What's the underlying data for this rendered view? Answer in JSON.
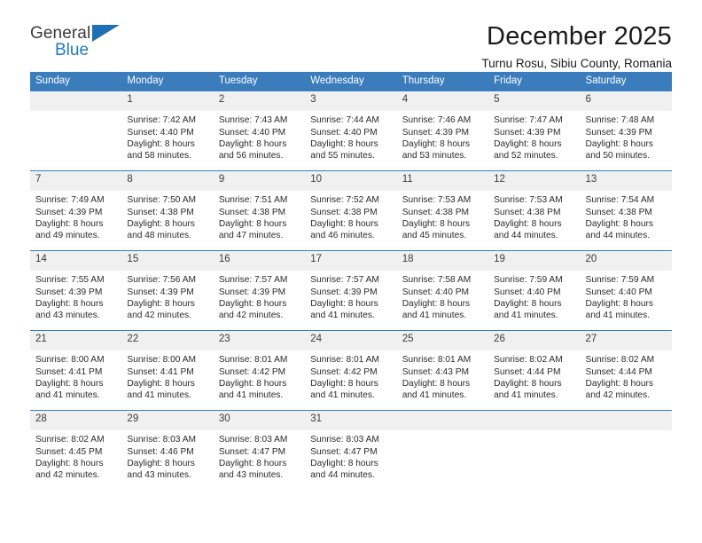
{
  "brand": {
    "name_top": "General",
    "name_bottom": "Blue",
    "triangle_color": "#1f6fb5",
    "text_color": "#3b3b3b",
    "accent_color": "#1f7ac4"
  },
  "header": {
    "title": "December 2025",
    "subtitle": "Turnu Rosu, Sibiu County, Romania"
  },
  "theme": {
    "header_bg": "#3b7cbd",
    "header_text": "#ffffff",
    "daynum_bg": "#f0f0f0",
    "grid_line": "#3b7cbd"
  },
  "weekday_headers": [
    "Sunday",
    "Monday",
    "Tuesday",
    "Wednesday",
    "Thursday",
    "Friday",
    "Saturday"
  ],
  "weeks": [
    [
      {
        "day": "",
        "sunrise": "",
        "sunset": "",
        "daylight_line1": "",
        "daylight_line2": ""
      },
      {
        "day": "1",
        "sunrise": "Sunrise: 7:42 AM",
        "sunset": "Sunset: 4:40 PM",
        "daylight_line1": "Daylight: 8 hours",
        "daylight_line2": "and 58 minutes."
      },
      {
        "day": "2",
        "sunrise": "Sunrise: 7:43 AM",
        "sunset": "Sunset: 4:40 PM",
        "daylight_line1": "Daylight: 8 hours",
        "daylight_line2": "and 56 minutes."
      },
      {
        "day": "3",
        "sunrise": "Sunrise: 7:44 AM",
        "sunset": "Sunset: 4:40 PM",
        "daylight_line1": "Daylight: 8 hours",
        "daylight_line2": "and 55 minutes."
      },
      {
        "day": "4",
        "sunrise": "Sunrise: 7:46 AM",
        "sunset": "Sunset: 4:39 PM",
        "daylight_line1": "Daylight: 8 hours",
        "daylight_line2": "and 53 minutes."
      },
      {
        "day": "5",
        "sunrise": "Sunrise: 7:47 AM",
        "sunset": "Sunset: 4:39 PM",
        "daylight_line1": "Daylight: 8 hours",
        "daylight_line2": "and 52 minutes."
      },
      {
        "day": "6",
        "sunrise": "Sunrise: 7:48 AM",
        "sunset": "Sunset: 4:39 PM",
        "daylight_line1": "Daylight: 8 hours",
        "daylight_line2": "and 50 minutes."
      }
    ],
    [
      {
        "day": "7",
        "sunrise": "Sunrise: 7:49 AM",
        "sunset": "Sunset: 4:39 PM",
        "daylight_line1": "Daylight: 8 hours",
        "daylight_line2": "and 49 minutes."
      },
      {
        "day": "8",
        "sunrise": "Sunrise: 7:50 AM",
        "sunset": "Sunset: 4:38 PM",
        "daylight_line1": "Daylight: 8 hours",
        "daylight_line2": "and 48 minutes."
      },
      {
        "day": "9",
        "sunrise": "Sunrise: 7:51 AM",
        "sunset": "Sunset: 4:38 PM",
        "daylight_line1": "Daylight: 8 hours",
        "daylight_line2": "and 47 minutes."
      },
      {
        "day": "10",
        "sunrise": "Sunrise: 7:52 AM",
        "sunset": "Sunset: 4:38 PM",
        "daylight_line1": "Daylight: 8 hours",
        "daylight_line2": "and 46 minutes."
      },
      {
        "day": "11",
        "sunrise": "Sunrise: 7:53 AM",
        "sunset": "Sunset: 4:38 PM",
        "daylight_line1": "Daylight: 8 hours",
        "daylight_line2": "and 45 minutes."
      },
      {
        "day": "12",
        "sunrise": "Sunrise: 7:53 AM",
        "sunset": "Sunset: 4:38 PM",
        "daylight_line1": "Daylight: 8 hours",
        "daylight_line2": "and 44 minutes."
      },
      {
        "day": "13",
        "sunrise": "Sunrise: 7:54 AM",
        "sunset": "Sunset: 4:38 PM",
        "daylight_line1": "Daylight: 8 hours",
        "daylight_line2": "and 44 minutes."
      }
    ],
    [
      {
        "day": "14",
        "sunrise": "Sunrise: 7:55 AM",
        "sunset": "Sunset: 4:39 PM",
        "daylight_line1": "Daylight: 8 hours",
        "daylight_line2": "and 43 minutes."
      },
      {
        "day": "15",
        "sunrise": "Sunrise: 7:56 AM",
        "sunset": "Sunset: 4:39 PM",
        "daylight_line1": "Daylight: 8 hours",
        "daylight_line2": "and 42 minutes."
      },
      {
        "day": "16",
        "sunrise": "Sunrise: 7:57 AM",
        "sunset": "Sunset: 4:39 PM",
        "daylight_line1": "Daylight: 8 hours",
        "daylight_line2": "and 42 minutes."
      },
      {
        "day": "17",
        "sunrise": "Sunrise: 7:57 AM",
        "sunset": "Sunset: 4:39 PM",
        "daylight_line1": "Daylight: 8 hours",
        "daylight_line2": "and 41 minutes."
      },
      {
        "day": "18",
        "sunrise": "Sunrise: 7:58 AM",
        "sunset": "Sunset: 4:40 PM",
        "daylight_line1": "Daylight: 8 hours",
        "daylight_line2": "and 41 minutes."
      },
      {
        "day": "19",
        "sunrise": "Sunrise: 7:59 AM",
        "sunset": "Sunset: 4:40 PM",
        "daylight_line1": "Daylight: 8 hours",
        "daylight_line2": "and 41 minutes."
      },
      {
        "day": "20",
        "sunrise": "Sunrise: 7:59 AM",
        "sunset": "Sunset: 4:40 PM",
        "daylight_line1": "Daylight: 8 hours",
        "daylight_line2": "and 41 minutes."
      }
    ],
    [
      {
        "day": "21",
        "sunrise": "Sunrise: 8:00 AM",
        "sunset": "Sunset: 4:41 PM",
        "daylight_line1": "Daylight: 8 hours",
        "daylight_line2": "and 41 minutes."
      },
      {
        "day": "22",
        "sunrise": "Sunrise: 8:00 AM",
        "sunset": "Sunset: 4:41 PM",
        "daylight_line1": "Daylight: 8 hours",
        "daylight_line2": "and 41 minutes."
      },
      {
        "day": "23",
        "sunrise": "Sunrise: 8:01 AM",
        "sunset": "Sunset: 4:42 PM",
        "daylight_line1": "Daylight: 8 hours",
        "daylight_line2": "and 41 minutes."
      },
      {
        "day": "24",
        "sunrise": "Sunrise: 8:01 AM",
        "sunset": "Sunset: 4:42 PM",
        "daylight_line1": "Daylight: 8 hours",
        "daylight_line2": "and 41 minutes."
      },
      {
        "day": "25",
        "sunrise": "Sunrise: 8:01 AM",
        "sunset": "Sunset: 4:43 PM",
        "daylight_line1": "Daylight: 8 hours",
        "daylight_line2": "and 41 minutes."
      },
      {
        "day": "26",
        "sunrise": "Sunrise: 8:02 AM",
        "sunset": "Sunset: 4:44 PM",
        "daylight_line1": "Daylight: 8 hours",
        "daylight_line2": "and 41 minutes."
      },
      {
        "day": "27",
        "sunrise": "Sunrise: 8:02 AM",
        "sunset": "Sunset: 4:44 PM",
        "daylight_line1": "Daylight: 8 hours",
        "daylight_line2": "and 42 minutes."
      }
    ],
    [
      {
        "day": "28",
        "sunrise": "Sunrise: 8:02 AM",
        "sunset": "Sunset: 4:45 PM",
        "daylight_line1": "Daylight: 8 hours",
        "daylight_line2": "and 42 minutes."
      },
      {
        "day": "29",
        "sunrise": "Sunrise: 8:03 AM",
        "sunset": "Sunset: 4:46 PM",
        "daylight_line1": "Daylight: 8 hours",
        "daylight_line2": "and 43 minutes."
      },
      {
        "day": "30",
        "sunrise": "Sunrise: 8:03 AM",
        "sunset": "Sunset: 4:47 PM",
        "daylight_line1": "Daylight: 8 hours",
        "daylight_line2": "and 43 minutes."
      },
      {
        "day": "31",
        "sunrise": "Sunrise: 8:03 AM",
        "sunset": "Sunset: 4:47 PM",
        "daylight_line1": "Daylight: 8 hours",
        "daylight_line2": "and 44 minutes."
      },
      {
        "day": "",
        "sunrise": "",
        "sunset": "",
        "daylight_line1": "",
        "daylight_line2": ""
      },
      {
        "day": "",
        "sunrise": "",
        "sunset": "",
        "daylight_line1": "",
        "daylight_line2": ""
      },
      {
        "day": "",
        "sunrise": "",
        "sunset": "",
        "daylight_line1": "",
        "daylight_line2": ""
      }
    ]
  ]
}
